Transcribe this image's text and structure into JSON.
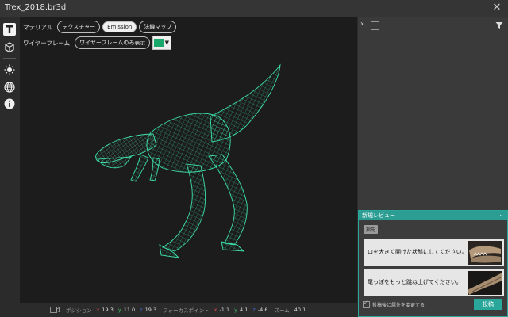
{
  "window": {
    "title": "Trex_2018.br3d"
  },
  "toolbar": {
    "row1_label": "マテリアル",
    "row1_pills": [
      "テクスチャー",
      "Emission",
      "法線マップ"
    ],
    "row1_active_index": 1,
    "row2_label": "ワイヤーフレーム",
    "row2_pill": "ワイヤーフレームのみ表示",
    "wire_color": "#18a86b"
  },
  "status": {
    "position_label": "ポジション",
    "position": {
      "x": "19.3",
      "y": "11.0",
      "z": "19.3"
    },
    "focus_label": "フォーカスポイント",
    "focus": {
      "x": "-1.1",
      "y": "4.1",
      "z": "-4.6"
    },
    "zoom_label": "ズーム",
    "zoom": "40.1"
  },
  "review": {
    "title": "新規レビュー",
    "tag": "指先",
    "items": [
      {
        "text": "口を大きく開けた状態にしてください。"
      },
      {
        "text": "尾っぽをもっと跳ね上げてください。"
      }
    ],
    "checkbox_label": "投稿後に属性を変更する",
    "post_label": "投稿"
  },
  "colors": {
    "accent": "#2aa79b",
    "wireframe": "#3ee0a8",
    "background": "#1c1c1c"
  }
}
